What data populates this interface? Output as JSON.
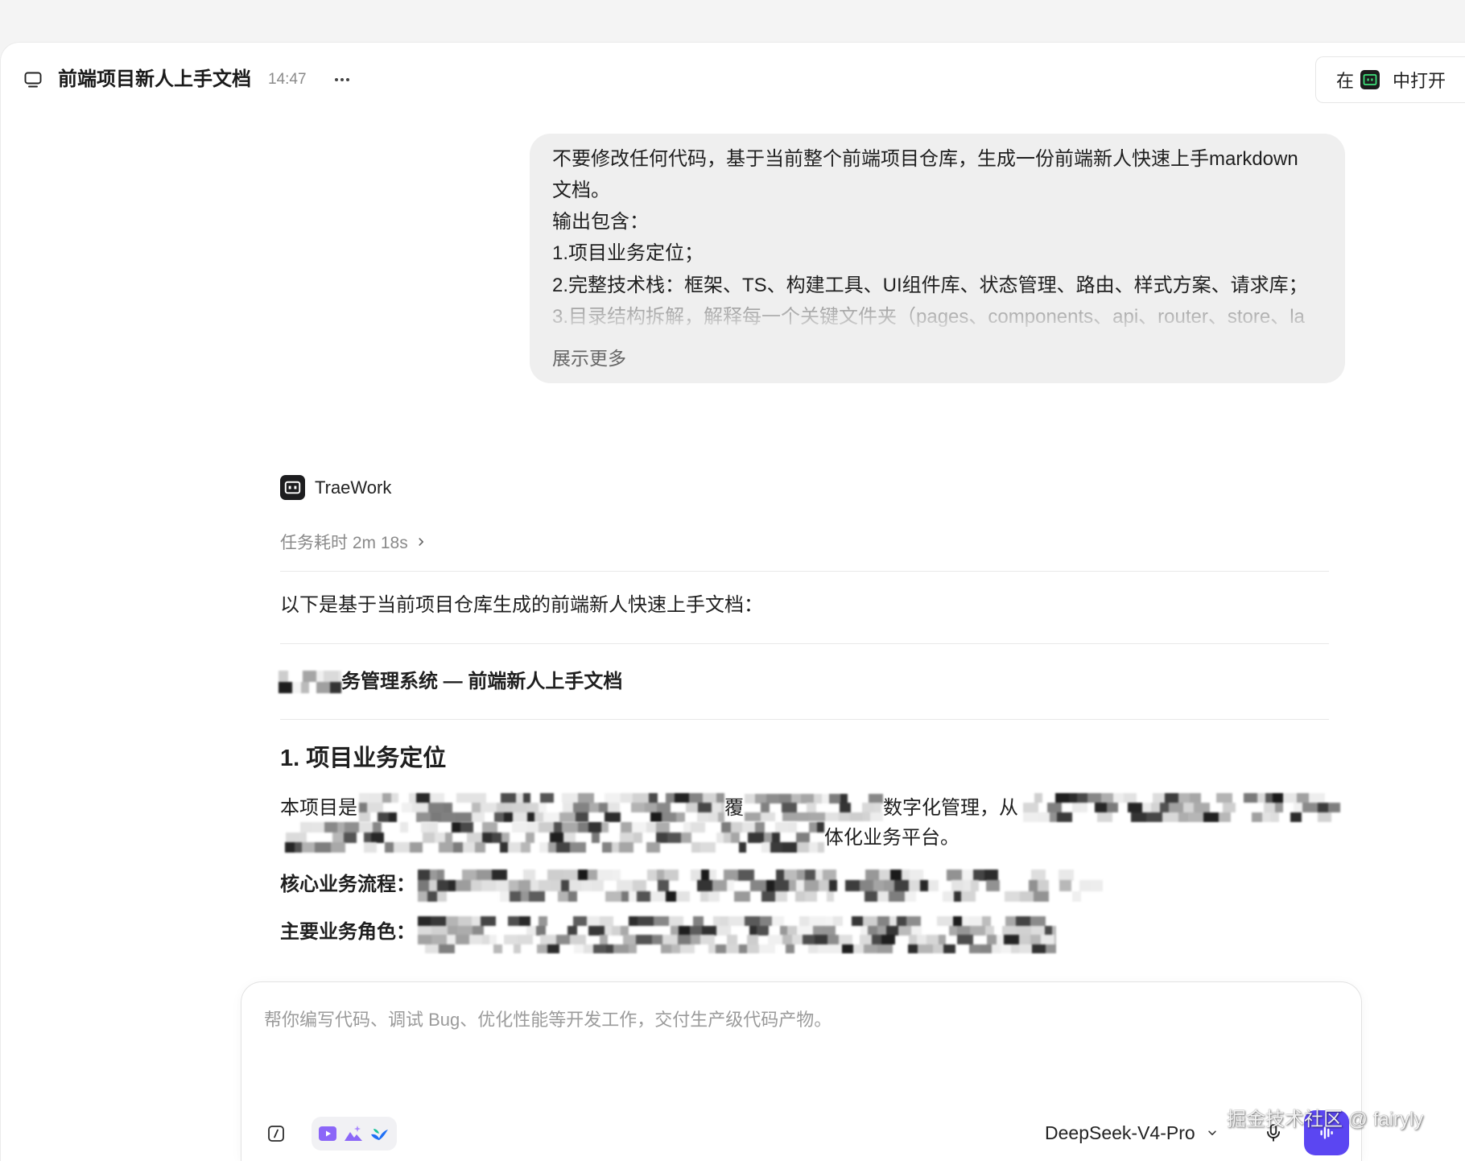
{
  "colors": {
    "accent": "#5b46f2",
    "bubble": "#efefef",
    "text": "#1f1f1f",
    "muted": "#8a8a8a",
    "divider": "#e8e8e8",
    "tool": "#8b66f8"
  },
  "header": {
    "icon": "chat-icon",
    "title": "前端项目新人上手文档",
    "time": "14:47",
    "more_icon": "ellipsis-icon",
    "open_in": {
      "prefix": "在",
      "icon": "trae-app-icon",
      "suffix": "中打开"
    }
  },
  "user_message": {
    "lines": [
      "不要修改任何代码，基于当前整个前端项目仓库，生成一份前端新人快速上手markdown",
      "文档。",
      "输出包含：",
      "1.项目业务定位；",
      "2.完整技术栈：框架、TS、构建工具、UI组件库、状态管理、路由、样式方案、请求库；"
    ],
    "faded_line": "3.目录结构拆解，解释每一个关键文件夹（pages、components、api、router、store、la",
    "show_more": "展示更多"
  },
  "assistant": {
    "icon": "traework-icon",
    "name": "TraeWork",
    "duration": "任务耗时 2m 18s",
    "duration_icon": "chevron-right-icon",
    "intro": "以下是基于当前项目仓库生成的前端新人快速上手文档：",
    "doc_title": "务管理系统 — 前端新人上手文档",
    "section_heading": "1. 项目业务定位",
    "paragraph": {
      "start": "本项目是",
      "mid_char": "覆",
      "mid": "数字化管理，从",
      "end": "体化业务平台。"
    },
    "core_flow_label": "核心业务流程：",
    "roles_label": "主要业务角色："
  },
  "composer": {
    "placeholder": "帮你编写代码、调试 Bug、优化性能等开发工作，交付生产级代码产物。",
    "slash_icon": "slash-command-icon",
    "tools": [
      "video-icon",
      "image-icon",
      "bird-logo-icon"
    ],
    "model": "DeepSeek-V4-Pro",
    "model_icon": "chevron-down-icon",
    "mic_icon": "microphone-icon",
    "send_icon": "waveform-icon"
  },
  "watermark": "掘金技术社区 @ fairyly"
}
